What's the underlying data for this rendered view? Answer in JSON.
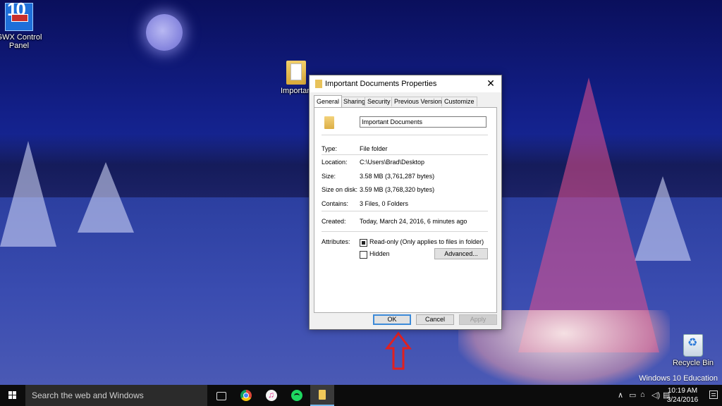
{
  "desktop": {
    "icons": [
      {
        "label": "GWX Control Panel"
      },
      {
        "label": "Important Documents"
      },
      {
        "label": "Recycle Bin"
      }
    ],
    "watermark": "Windows 10 Education",
    "gwx_badge": "10"
  },
  "dialog": {
    "title": "Important Documents Properties",
    "close_glyph": "✕",
    "tabs": [
      "General",
      "Sharing",
      "Security",
      "Previous Versions",
      "Customize"
    ],
    "active_tab": "General",
    "name_value": "Important Documents",
    "props": {
      "type_label": "Type:",
      "type_value": "File folder",
      "location_label": "Location:",
      "location_value": "C:\\Users\\Brad\\Desktop",
      "size_label": "Size:",
      "size_value": "3.58 MB (3,761,287 bytes)",
      "size_on_disk_label": "Size on disk:",
      "size_on_disk_value": "3.59 MB (3,768,320 bytes)",
      "contains_label": "Contains:",
      "contains_value": "3 Files, 0 Folders",
      "created_label": "Created:",
      "created_value": "Today, March 24, 2016, 6 minutes ago",
      "attributes_label": "Attributes:"
    },
    "attributes": {
      "readonly_label": "Read-only (Only applies to files in folder)",
      "hidden_label": "Hidden",
      "advanced_label": "Advanced..."
    },
    "buttons": {
      "ok": "OK",
      "cancel": "Cancel",
      "apply": "Apply"
    }
  },
  "taskbar": {
    "search_placeholder": "Search the web and Windows",
    "clock_time": "10:19 AM",
    "clock_date": "3/24/2016",
    "tray_chevron": "∧",
    "tray_volume": "◁)",
    "tray_network": "▭"
  },
  "colors": {
    "arrow": "#e02020",
    "ok_focus": "#3c8ad8",
    "taskbar": "#0c0c0c"
  }
}
